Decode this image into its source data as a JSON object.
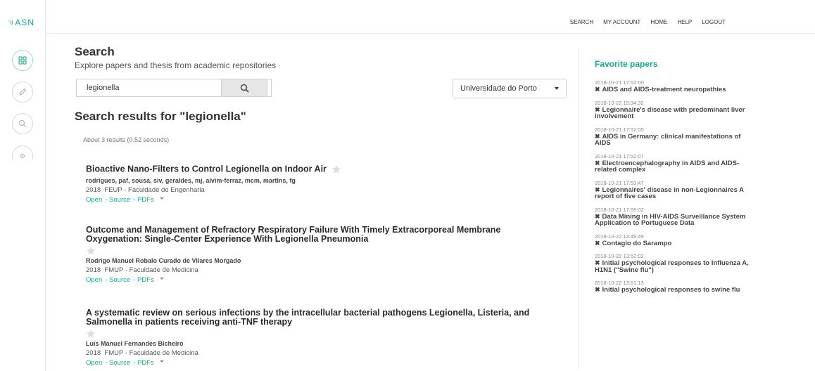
{
  "app": {
    "logo_text": "ASN"
  },
  "sidebar": {
    "icons": [
      "grid-icon",
      "pencil-icon",
      "search-icon",
      "settings-icon"
    ]
  },
  "topnav": [
    "SEARCH",
    "MY ACCOUNT",
    "HOME",
    "HELP",
    "LOGOUT"
  ],
  "search": {
    "title": "Search",
    "subtitle": "Explore papers and thesis from academic repositories",
    "query": "legionella",
    "repository": "Universidade do Porto"
  },
  "results": {
    "heading": "Search results for \"legionella\"",
    "about": "About 3 results (0.52 seconds)",
    "items": [
      {
        "title": "Bioactive Nano-Filters to Control Legionella on Indoor Air",
        "authors": "rodrigues, paf, sousa, siv, geraldes, mj, alvim-ferraz, mcm, martins, fg",
        "year": "2018",
        "source": "FEUP - Faculdade de Engenharia",
        "links": [
          "Open",
          "- Source",
          "- PDFs"
        ]
      },
      {
        "title": "Outcome and Management of Refractory Respiratory Failure With Timely Extracorporeal Membrane Oxygenation: Single-Center Experience With Legionella Pneumonia",
        "authors": "Rodrigo Manuel Robalo Curado de Vilares Morgado",
        "year": "2018",
        "source": "FMUP - Faculdade de Medicina",
        "links": [
          "Open",
          "- Source",
          "- PDFs"
        ]
      },
      {
        "title": "A systematic review on serious infections by the intracellular bacterial pathogens Legionella, Listeria, and Salmonella in patients receiving anti-TNF therapy",
        "authors": "Luís Manuel Fernandes Bicheiro",
        "year": "2018",
        "source": "FMUP - Faculdade de Medicina",
        "links": [
          "Open",
          "- Source",
          "- PDFs"
        ]
      }
    ]
  },
  "favorites": {
    "title": "Favorite papers",
    "items": [
      {
        "time": "2018-10-21 17:52:00",
        "title": "AIDS and AIDS-treatment neuropathies"
      },
      {
        "time": "2018-10-22 15:34:32",
        "title": "Legionnaire's disease with predominant liver involvement"
      },
      {
        "time": "2018-10-21 17:52:05",
        "title": "AIDS in Germany: clinical manifestations of AIDS"
      },
      {
        "time": "2018-10-21 17:52:07",
        "title": "Electroencephalography in AIDS and AIDS-related complex"
      },
      {
        "time": "2018-10-21 17:53:47",
        "title": "Legionnaires' disease in non-Legionnaires A report of five cases"
      },
      {
        "time": "2018-10-21 17:59:02",
        "title": "Data Mining in HIV-AIDS Surveillance System Application to Portuguese Data"
      },
      {
        "time": "2018-10-22 13:49:49",
        "title": "Contagio do Sarampo"
      },
      {
        "time": "2018-10-22 13:52:02",
        "title": "Initial psychological responses to Influenza A, H1N1 (\"Swine flu\")"
      },
      {
        "time": "2018-10-22 13:51:13",
        "title": "Initial psychological responses to swine flu"
      }
    ]
  },
  "colors": {
    "accent": "#1aa68a",
    "text": "#333333"
  }
}
